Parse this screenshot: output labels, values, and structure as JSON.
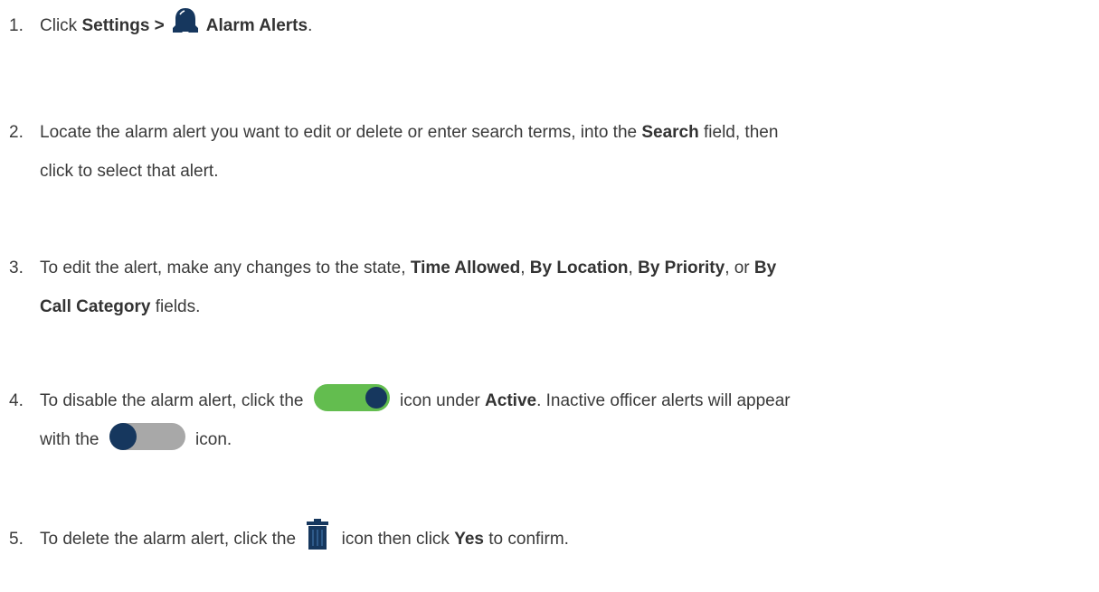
{
  "colors": {
    "text": "#3a3a3a",
    "navy": "#16375e",
    "toggle_green": "#63bd4f",
    "toggle_gray": "#a8a8a8"
  },
  "icons": {
    "bell": "bell-icon",
    "toggle_on": "toggle-on-icon",
    "toggle_off": "toggle-off-icon",
    "trash": "trash-icon"
  },
  "steps": [
    {
      "num": "1.",
      "t1": "Click ",
      "b1": "Settings >",
      "b2": "Alarm Alerts",
      "t2": "."
    },
    {
      "num": "2.",
      "t1": "Locate the alarm alert you want to edit or delete or enter search terms, into the ",
      "b1": "Search",
      "t2": " field, then",
      "t3": "click to select that alert."
    },
    {
      "num": "3.",
      "t1": "To edit the alert, make any changes to the state, ",
      "b1": "Time Allowed",
      "t2": ", ",
      "b2": "By Location",
      "t3": ", ",
      "b3": "By Priority",
      "t4": ", or ",
      "b4": "By",
      "b5": "Call Category",
      "t5": " fields."
    },
    {
      "num": "4.",
      "t1": "To disable the alarm alert, click the ",
      "t2": " icon under ",
      "b1": "Active",
      "t3": ". Inactive officer alerts will appear",
      "t4": "with the ",
      "t5": " icon."
    },
    {
      "num": "5.",
      "t1": "To delete the alarm alert, click the ",
      "t2": " icon then click ",
      "b1": "Yes",
      "t3": " to confirm."
    }
  ]
}
